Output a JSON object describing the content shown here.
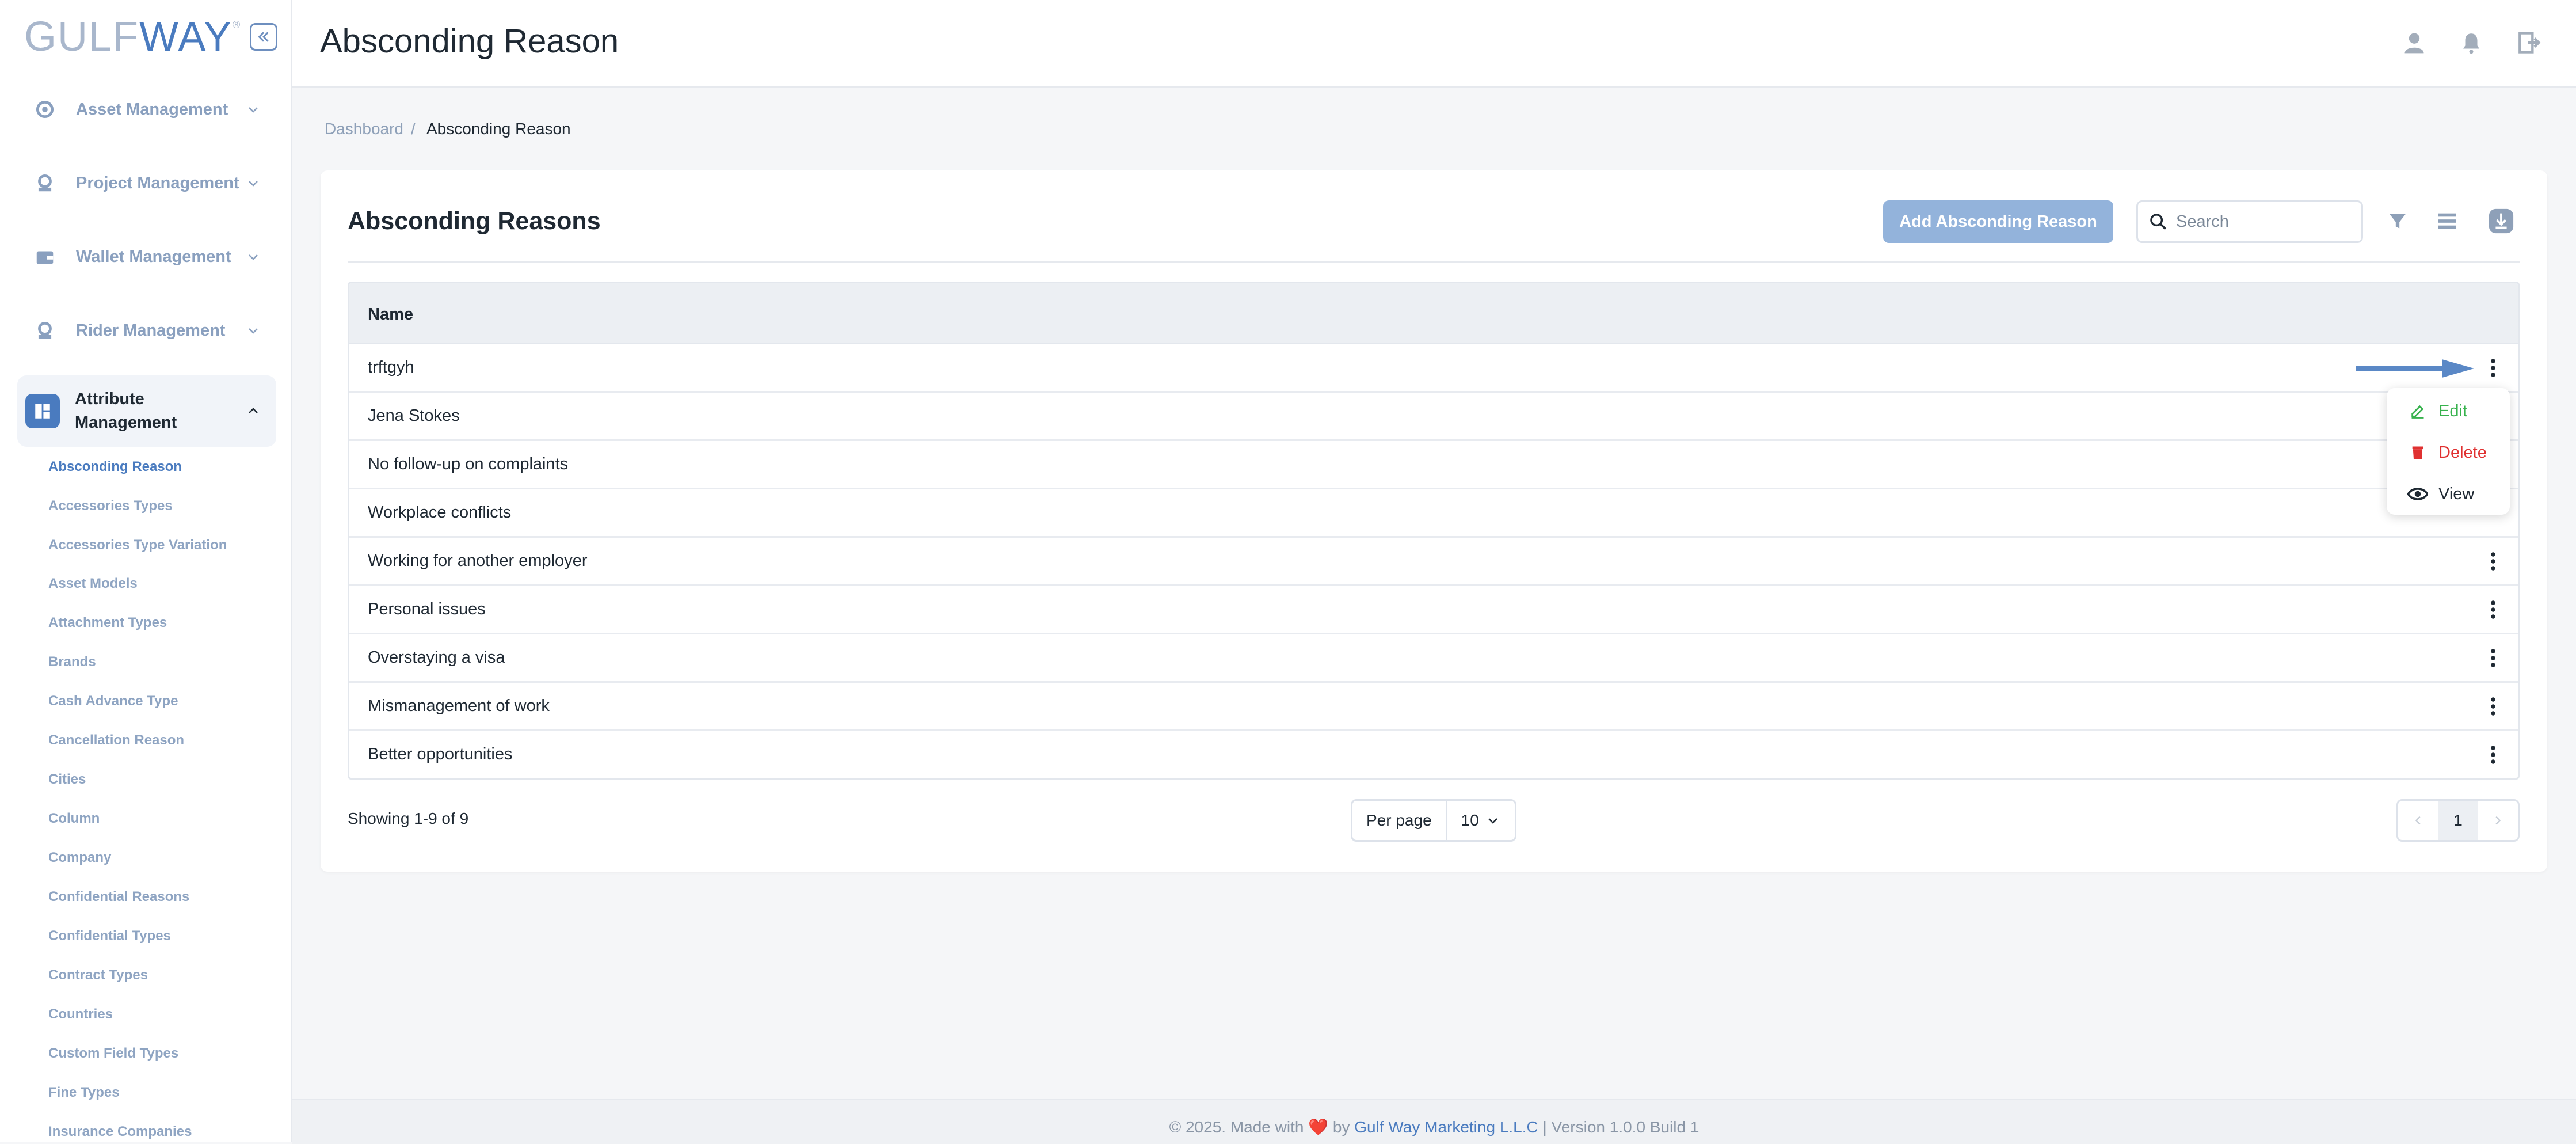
{
  "brand": {
    "logo_part1": "GULF",
    "logo_part2": "WAY",
    "trademark": "®"
  },
  "sidebar": {
    "sections": [
      {
        "label": "Asset Management",
        "icon": "asset-icon"
      },
      {
        "label": "Project Management",
        "icon": "project-icon"
      },
      {
        "label": "Wallet Management",
        "icon": "wallet-icon"
      },
      {
        "label": "Rider Management",
        "icon": "rider-icon"
      }
    ],
    "active_section": {
      "label": "Attribute Management",
      "icon": "attribute-icon"
    },
    "sub_items": [
      "Absconding Reason",
      "Accessories Types",
      "Accessories Type Variation",
      "Asset Models",
      "Attachment Types",
      "Brands",
      "Cash Advance Type",
      "Cancellation Reason",
      "Cities",
      "Column",
      "Company",
      "Confidential Reasons",
      "Confidential Types",
      "Contract Types",
      "Countries",
      "Custom Field Types",
      "Fine Types",
      "Insurance Companies"
    ]
  },
  "header": {
    "title": "Absconding Reason"
  },
  "breadcrumb": {
    "home": "Dashboard",
    "separator": "/",
    "current": "Absconding Reason"
  },
  "card": {
    "title": "Absconding Reasons",
    "add_button": "Add Absconding Reason",
    "search_placeholder": "Search"
  },
  "table": {
    "column_name": "Name",
    "rows": [
      "trftgyh",
      "Jena Stokes",
      "No follow-up on complaints",
      "Workplace conflicts",
      "Working for another employer",
      "Personal issues",
      "Overstaying a visa",
      "Mismanagement of work",
      "Better opportunities"
    ]
  },
  "row_menu": {
    "edit": "Edit",
    "delete": "Delete",
    "view": "View"
  },
  "pagination": {
    "showing": "Showing 1-9 of 9",
    "per_page_label": "Per page",
    "per_page_value": "10",
    "current_page": "1"
  },
  "footer": {
    "prefix": "© 2025. Made with",
    "heart": "❤️",
    "by": "by",
    "company": "Gulf Way Marketing L.L.C",
    "version": "| Version 1.0.0 Build 1"
  },
  "colors": {
    "accent": "#4a7bbf",
    "edit": "#37b24d",
    "delete": "#e03131",
    "add_button": "#93b3db"
  }
}
